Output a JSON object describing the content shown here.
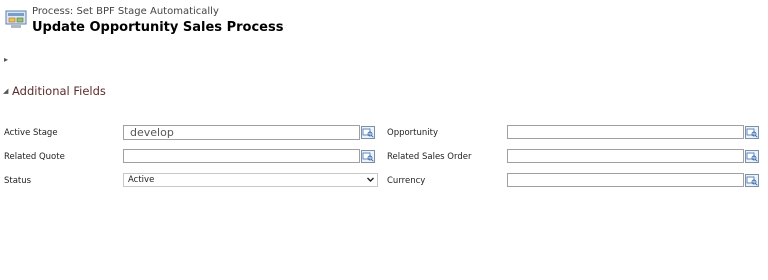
{
  "process": {
    "subtitle": "Process: Set BPF Stage Automatically",
    "title": "Update Opportunity Sales Process"
  },
  "section": {
    "title": "Additional Fields"
  },
  "fields": {
    "active_stage": {
      "label": "Active Stage",
      "value": "develop"
    },
    "related_quote": {
      "label": "Related Quote",
      "value": ""
    },
    "status": {
      "label": "Status",
      "value": "Active"
    },
    "opportunity": {
      "label": "Opportunity",
      "value": ""
    },
    "related_sales_order": {
      "label": "Related Sales Order",
      "value": ""
    },
    "currency": {
      "label": "Currency",
      "value": ""
    }
  },
  "icons": {
    "process": "workflow-step-icon",
    "lookup": "lookup-search-icon",
    "expand": "triangle-right-icon",
    "collapse": "triangle-down-icon",
    "dropdown": "chevron-down-icon"
  },
  "colors": {
    "section_title": "#5a2d2d",
    "lookup_icon": "#3b6db3"
  }
}
